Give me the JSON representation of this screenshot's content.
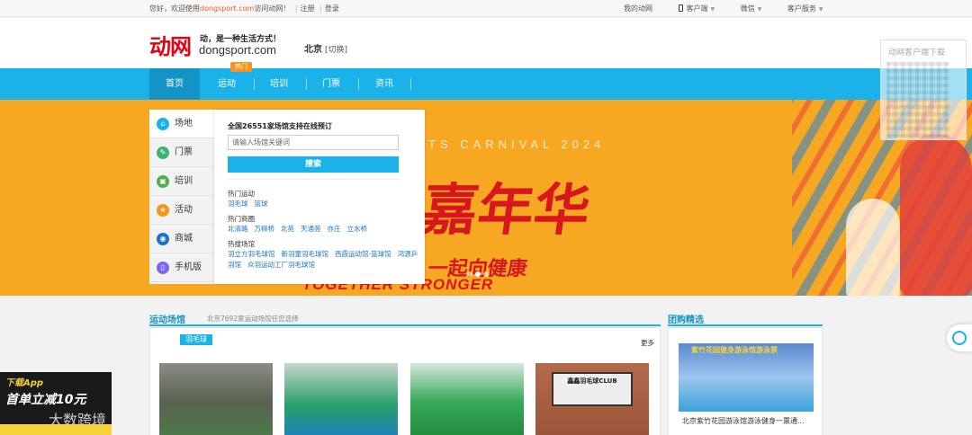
{
  "topbar": {
    "welcome_prefix": "您好，欢迎使用",
    "welcome_domain": "dongsport.com",
    "welcome_suffix": "访问动网！",
    "register": "注册",
    "login": "登录",
    "my_dongwang": "我的动网",
    "client": "客户端",
    "wechat": "微信",
    "service": "客户服务"
  },
  "header": {
    "logo_cn": "动网",
    "logo_slogan": "动，是一种生活方式！",
    "logo_domain": "dongsport.com",
    "city": "北京",
    "city_switch": "[切换]",
    "qr_title": "动网客户端下载"
  },
  "nav": {
    "hot_badge": "热门",
    "items": [
      "首页",
      "运动",
      "培训",
      "门票",
      "资讯"
    ]
  },
  "banner": {
    "carnival_text": "TS CARNIVAL 2024",
    "headline": "嘉年华",
    "sub": "一起向健康",
    "together": "TOGETHER STRONGER"
  },
  "side_menu": {
    "items": [
      {
        "label": "场地",
        "icon": "venue-icon",
        "color": "#1ab2e8"
      },
      {
        "label": "门票",
        "icon": "ticket-icon",
        "color": "#3cb371"
      },
      {
        "label": "培训",
        "icon": "training-icon",
        "color": "#4caf50"
      },
      {
        "label": "活动",
        "icon": "trophy-icon",
        "color": "#f7941d"
      },
      {
        "label": "商城",
        "icon": "shop-icon",
        "color": "#1a73c9"
      },
      {
        "label": "手机版",
        "icon": "mobile-icon",
        "color": "#7b68ee"
      }
    ]
  },
  "search_panel": {
    "title": "全国26551家场馆支持在线预订",
    "placeholder": "请输入场馆关键词",
    "button": "搜索",
    "hot_sports_label": "热门运动",
    "hot_sports": [
      "羽毛球",
      "篮球"
    ],
    "hot_districts_label": "热门商圈",
    "hot_districts": [
      "北清路",
      "万柳桥",
      "北苑",
      "天通苑",
      "亦庄",
      "立水桥"
    ],
    "hot_venues_label": "热搜场馆",
    "hot_venues_line1": [
      "羽立方羽毛球馆",
      "新羽童羽毛球馆",
      "西霞运动馆-篮球馆",
      "鸿源乒"
    ],
    "hot_venues_line2": [
      "羽馆",
      "众羽运动工厂羽毛球馆"
    ]
  },
  "venues": {
    "title": "运动场馆",
    "subtitle": "北京7692家运动场馆任您选择",
    "tab": "羽毛球",
    "more": "更多",
    "thumb4_sign": "鑫鑫羽毛球CLUB"
  },
  "group": {
    "title": "团购精选",
    "img_text": "紫竹花园健身游泳馆游泳票",
    "caption": "北京紫竹花园游泳馆游泳健身一票通..."
  },
  "promo": {
    "line1": "下载App",
    "line2": "首单立减10元",
    "line3": "大数跨境"
  }
}
